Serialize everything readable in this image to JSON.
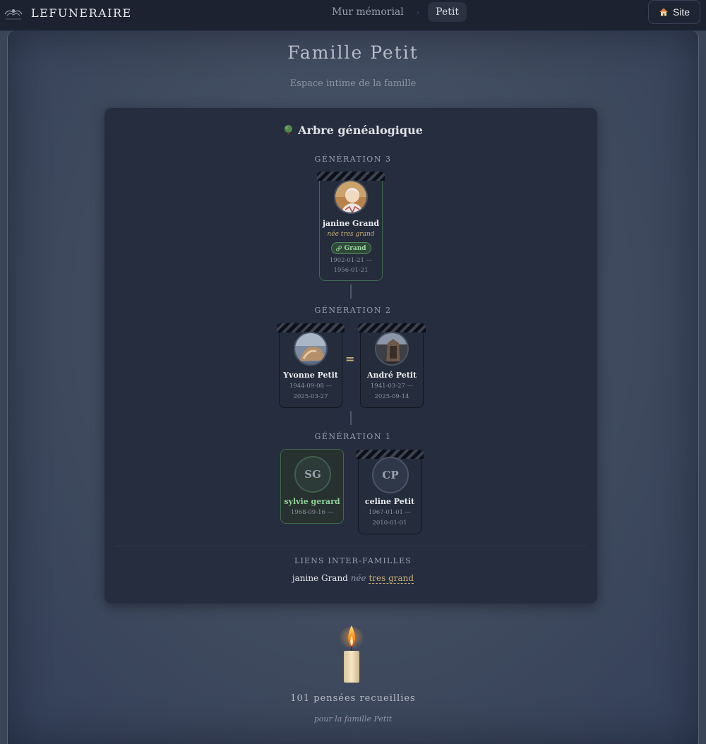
{
  "brand": {
    "name": "LEFUNERAIRE"
  },
  "breadcrumb": {
    "wall": "Mur mémorial",
    "current": "Petit"
  },
  "site_button": {
    "label": "Site",
    "icon": "home-icon"
  },
  "page": {
    "title": "Famille Petit",
    "subtitle": "Espace intime de la famille"
  },
  "tree": {
    "title": "Arbre généalogique",
    "generations": [
      {
        "label": "GÉNÉRATION 3",
        "people": [
          {
            "name": "janine Grand",
            "nee": "née tres grand",
            "badge": "Grand",
            "dates": [
              "1902-01-21 —",
              "1956-01-21"
            ]
          }
        ]
      },
      {
        "label": "GÉNÉRATION 2",
        "people": [
          {
            "name": "Yvonne Petit",
            "dates": [
              "1944-09-08 —",
              "2025-03-27"
            ]
          },
          {
            "name": "André Petit",
            "dates": [
              "1941-03-27 —",
              "2025-09-14"
            ]
          }
        ],
        "spouse_sign": "="
      },
      {
        "label": "GÉNÉRATION 1",
        "people": [
          {
            "name": "sylvie gerard",
            "initials": "SG",
            "dates": [
              "1968-09-16 —"
            ]
          },
          {
            "name": "celine Petit",
            "initials": "CP",
            "dates": [
              "1967-01-01 —",
              "2010-01-01"
            ]
          }
        ]
      }
    ],
    "links": {
      "title": "LIENS INTER-FAMILLES",
      "person": "janine Grand",
      "nee_word": "née",
      "family": "tres grand"
    }
  },
  "memorial": {
    "count_text": "101 pensées recueillies",
    "sub": "pour la famille Petit"
  },
  "colors": {
    "accent_gold": "#c9b07a",
    "accent_green": "#8fd29a",
    "panel": "#262d3e"
  }
}
